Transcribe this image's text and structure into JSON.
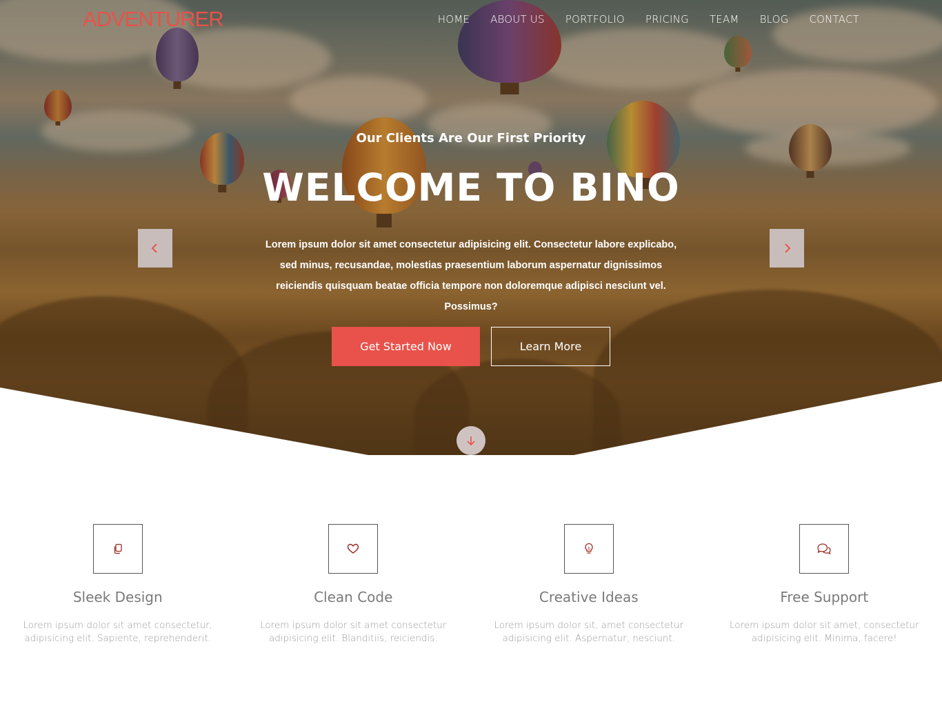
{
  "brand": {
    "name": "ADVENTURER"
  },
  "nav": {
    "items": [
      "HOME",
      "ABOUT US",
      "PORTFOLIO",
      "PRICING",
      "TEAM",
      "BLOG",
      "CONTACT"
    ]
  },
  "hero": {
    "subtitle": "Our Clients Are Our First Priority",
    "title": "WELCOME TO BINO",
    "description": "Lorem ipsum dolor sit amet consectetur adipisicing elit. Consectetur labore explicabo, sed minus, recusandae, molestias praesentium laborum aspernatur dignissimos reiciendis quisquam beatae officia tempore non doloremque adipisci nesciunt vel. Possimus?",
    "primary_button": "Get Started Now",
    "secondary_button": "Learn More",
    "prev_icon": "chevron-left-icon",
    "next_icon": "chevron-right-icon",
    "scroll_icon": "arrow-down-icon"
  },
  "features": [
    {
      "icon": "copy-icon",
      "title": "Sleek Design",
      "text": "Lorem ipsum dolor sit amet consectetur, adipisicing elit. Sapiente, reprehenderit."
    },
    {
      "icon": "heart-icon",
      "title": "Clean Code",
      "text": "Lorem ipsum dolor sit amet consectetur adipisicing elit. Blanditiis, reiciendis."
    },
    {
      "icon": "lightbulb-icon",
      "title": "Creative Ideas",
      "text": "Lorem ipsum dolor sit, amet consectetur adipisicing elit. Aspernatur, nesciunt."
    },
    {
      "icon": "chat-icon",
      "title": "Free Support",
      "text": "Lorem ipsum dolor sit amet, consectetur adipisicing elit. Minima, facere!"
    }
  ],
  "colors": {
    "accent": "#e8524a",
    "arrow_bg": "#c9bdbc",
    "feature_text": "#9a9a9a"
  }
}
